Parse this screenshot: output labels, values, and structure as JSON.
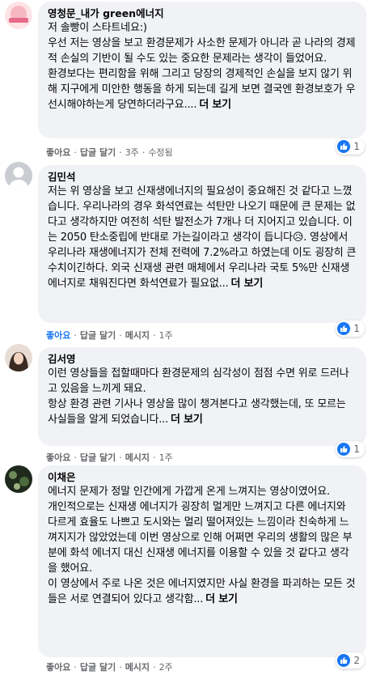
{
  "colors": {
    "bubble": "#f0f2f5",
    "meta": "#65676b",
    "like": "#1877f2"
  },
  "comments": [
    {
      "author": "영청문_내가 green에너지",
      "paragraphs": [
        "저 솔빵이 스타트네요:)",
        "우선 저는 영상을 보고 환경문제가 사소한 문제가 아니라 곧 나라의 경제적 손실의 기반이 될 수도 있는 중요한 문제라는 생각이 들었어요.",
        "환경보다는 편리함을 위해 그리고 당장의 경제적인 손실을 보지 않기 위해 지구에게 미안한 행동을 하게 되는데 길게 보면 결국엔 환경보호가 우선시해야하는게 당연하더라구요...."
      ],
      "more_label": "더 보기",
      "actions": [
        "좋아요",
        "답글 달기",
        "3주",
        "수정됨"
      ],
      "reactions": "1"
    },
    {
      "author": "김민석",
      "paragraphs": [
        "저는 위 영상을 보고 신재생에너지의 필요성이 중요해진 것 같다고 느꼈습니다. 우리나라의 경우 화석연료는 석탄만 나오기 때문에 큰 문제는 없다고 생각하지만 여전히 석탄 발전소가 7개나 더 지어지고 있습니다. 이는 2050 탄소중립에 반대로 가는길이라고 생각이 듭니다😥. 영상에서 우리나라 재생에너지가 전체 전력에 7.2%라고 하였는데 이도 굉장히 큰수치이긴하다. 외국 신재생 관련 매체에서 우리나라 국토 5%만 신재생에너지로 채워진다면 화석연료가 필요없..."
      ],
      "more_label": "더 보기",
      "actions": [
        "좋아요",
        "답글 달기",
        "메시지",
        "1주"
      ],
      "reactions": "1"
    },
    {
      "author": "김서영",
      "paragraphs": [
        "이런 영상들을 접할때마다 환경문제의 심각성이 점점 수면 위로 드러나고 있음을 느끼게 돼요.",
        "항상 환경 관련 기사나 영상을 많이 챙겨본다고 생각했는데, 또 모르는 사실들을 알게 되었습니다..."
      ],
      "more_label": "더 보기",
      "actions": [
        "좋아요",
        "답글 달기",
        "메시지",
        "1주"
      ],
      "reactions": "1"
    },
    {
      "author": "이채은",
      "paragraphs": [
        "에너지 문제가 정말 인간에게 가깝게 온게 느껴지는 영상이였어요.",
        "개인적으로는 신재생 에너지가 굉장히 멀게만 느껴지고 다른 에너지와 다르게 효율도 나쁘고 도시와는 멀리 떨어져있는 느낌이라 친숙하게 느껴지지가 않았었는데 이번 영상으로 인해 어쩌면 우리의 생활의 많은 부분에 화석 에너지 대신 신재생 에너지를 이용할 수 있을 것 같다고 생각을 했어요.",
        "이 영상에서 주로 나온 것은 에너지였지만 사실 환경을 파괴하는 모든 것들은 서로 연결되어 있다고 생각함..."
      ],
      "more_label": "더 보기",
      "actions": [
        "좋아요",
        "답글 달기",
        "메시지",
        "2주"
      ],
      "reactions": "2"
    }
  ]
}
